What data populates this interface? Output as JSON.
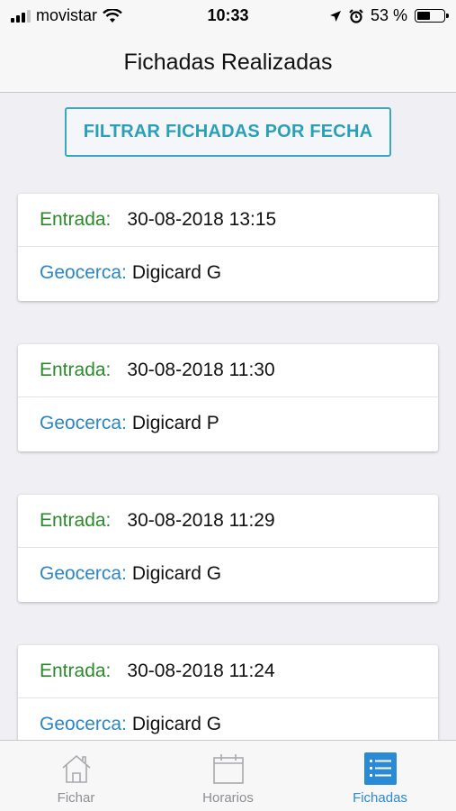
{
  "status": {
    "carrier": "movistar",
    "time": "10:33",
    "battery_text": "53 %",
    "battery_level": 0.53
  },
  "nav": {
    "title": "Fichadas Realizadas"
  },
  "filter_button": {
    "label": "FILTRAR FICHADAS POR FECHA"
  },
  "records": [
    {
      "entrada_label": "Entrada:",
      "entrada_value": "30-08-2018 13:15",
      "geocerca_label": "Geocerca:",
      "geocerca_value": "Digicard G"
    },
    {
      "entrada_label": "Entrada:",
      "entrada_value": "30-08-2018 11:30",
      "geocerca_label": "Geocerca:",
      "geocerca_value": "Digicard P"
    },
    {
      "entrada_label": "Entrada:",
      "entrada_value": "30-08-2018 11:29",
      "geocerca_label": "Geocerca:",
      "geocerca_value": "Digicard G"
    },
    {
      "entrada_label": "Entrada:",
      "entrada_value": "30-08-2018 11:24",
      "geocerca_label": "Geocerca:",
      "geocerca_value": "Digicard G"
    }
  ],
  "tabs": [
    {
      "label": "Fichar",
      "icon": "home-icon",
      "active": false
    },
    {
      "label": "Horarios",
      "icon": "calendar-icon",
      "active": false
    },
    {
      "label": "Fichadas",
      "icon": "list-icon",
      "active": true
    }
  ],
  "colors": {
    "accent": "#2aa0b8",
    "entrada": "#2a8a2a",
    "geocerca": "#2b86c5",
    "tab_active": "#2a8ad6"
  }
}
